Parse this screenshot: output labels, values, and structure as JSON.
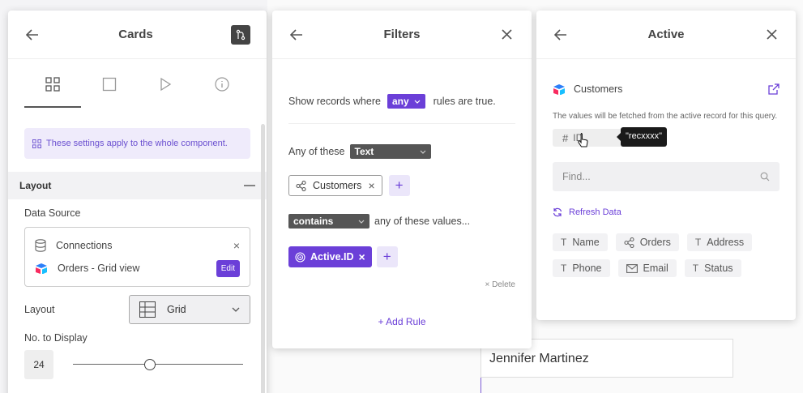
{
  "cards_panel": {
    "title": "Cards",
    "notice": "These settings apply to the whole component.",
    "section_title": "Layout",
    "data_source_label": "Data Source",
    "connections_label": "Connections",
    "source_name": "Orders - Grid view",
    "edit_label": "Edit",
    "layout_label": "Layout",
    "layout_value": "Grid",
    "display_label": "No. to Display",
    "display_value": "24",
    "display_fraction": 0.45
  },
  "filters_panel": {
    "title": "Filters",
    "show_prefix": "Show records where",
    "any_value": "any",
    "show_suffix": "rules are true.",
    "any_of_these": "Any of these",
    "type_value": "Text",
    "customers_chip": "Customers",
    "operator_value": "contains",
    "values_text": "any of these values...",
    "value_chip": "Active.ID",
    "delete_label": "× Delete",
    "add_rule_label": "+ Add Rule"
  },
  "active_panel": {
    "title": "Active",
    "table_name": "Customers",
    "description": "The values will be fetched from the active record for this query.",
    "id_label": "ID",
    "tooltip": "\"recxxxx\"",
    "find_placeholder": "Find...",
    "refresh_label": "Refresh Data",
    "fields": [
      {
        "label": "Name",
        "icon": "T"
      },
      {
        "label": "Orders",
        "icon": "link"
      },
      {
        "label": "Address",
        "icon": "T"
      },
      {
        "label": "Phone",
        "icon": "T"
      },
      {
        "label": "Email",
        "icon": "mail"
      },
      {
        "label": "Status",
        "icon": "T"
      }
    ]
  },
  "background": {
    "card_name": "Jennifer Martinez"
  },
  "colors": {
    "accent": "#6b3fd8",
    "dark": "#555555"
  }
}
